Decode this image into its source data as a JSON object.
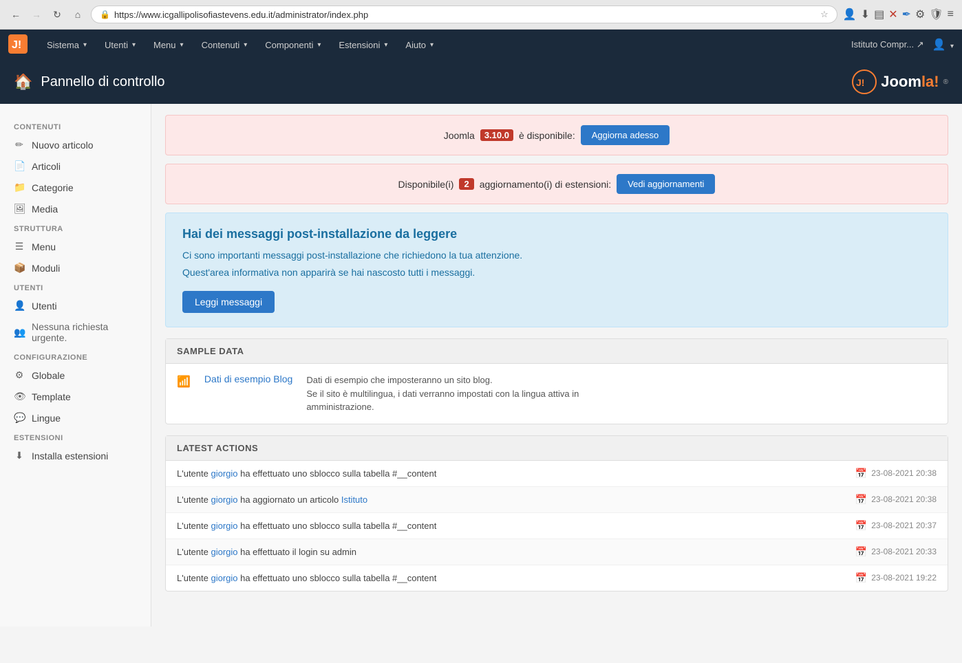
{
  "browser": {
    "url": "https://www.icgallipolisofiastevens.edu.it/administrator/index.php",
    "back_disabled": false,
    "forward_disabled": true
  },
  "topnav": {
    "items": [
      {
        "label": "Sistema",
        "has_dropdown": true
      },
      {
        "label": "Utenti",
        "has_dropdown": true
      },
      {
        "label": "Menu",
        "has_dropdown": true
      },
      {
        "label": "Contenuti",
        "has_dropdown": true
      },
      {
        "label": "Componenti",
        "has_dropdown": true
      },
      {
        "label": "Estensioni",
        "has_dropdown": true
      },
      {
        "label": "Aiuto",
        "has_dropdown": true
      }
    ],
    "site_link": "Istituto Compr... ↗",
    "user_icon": "👤"
  },
  "page_header": {
    "title": "Pannello di controllo",
    "icon": "🏠",
    "brand": "Joomla!"
  },
  "alerts": [
    {
      "pre_text": "Joomla",
      "version": "3.10.0",
      "post_text": "è disponibile:",
      "button_label": "Aggiorna adesso"
    },
    {
      "pre_text": "Disponibile(i)",
      "count": "2",
      "post_text": "aggiornamento(i) di estensioni:",
      "button_label": "Vedi aggiornamenti"
    }
  ],
  "info_box": {
    "title": "Hai dei messaggi post-installazione da leggere",
    "lines": [
      "Ci sono importanti messaggi post-installazione che richiedono la tua attenzione.",
      "Quest'area informativa non apparirà se hai nascosto tutti i messaggi."
    ],
    "button_label": "Leggi messaggi"
  },
  "sample_data": {
    "section_title": "SAMPLE DATA",
    "items": [
      {
        "icon": "📶",
        "link": "Dati di esempio Blog",
        "desc_lines": [
          "Dati di esempio che imposteranno un sito blog.",
          "Se il sito è multilingua, i dati verranno impostati con la lingua attiva in",
          "amministrazione."
        ]
      }
    ]
  },
  "latest_actions": {
    "section_title": "LATEST ACTIONS",
    "items": [
      {
        "text_pre": "L'utente",
        "user_link": "giorgio",
        "text_mid": "ha effettuato uno sblocco sulla tabella #__content",
        "text_post": "",
        "page_link": "",
        "date": "23-08-2021 20:38"
      },
      {
        "text_pre": "L'utente",
        "user_link": "giorgio",
        "text_mid": "ha aggiornato un articolo",
        "text_post": "",
        "page_link": "Istituto",
        "date": "23-08-2021 20:38"
      },
      {
        "text_pre": "L'utente",
        "user_link": "giorgio",
        "text_mid": "ha effettuato uno sblocco sulla tabella #__content",
        "text_post": "",
        "page_link": "",
        "date": "23-08-2021 20:37"
      },
      {
        "text_pre": "L'utente",
        "user_link": "giorgio",
        "text_mid": "ha effettuato il login su admin",
        "text_post": "",
        "page_link": "",
        "date": "23-08-2021 20:33"
      },
      {
        "text_pre": "L'utente",
        "user_link": "giorgio",
        "text_mid": "ha effettuato uno sblocco sulla tabella #__content",
        "text_post": "",
        "page_link": "",
        "date": "23-08-2021 19:22"
      }
    ]
  },
  "sidebar": {
    "sections": [
      {
        "title": "CONTENUTI",
        "items": [
          {
            "icon": "✏️",
            "label": "Nuovo articolo",
            "interactable": true
          },
          {
            "icon": "📋",
            "label": "Articoli",
            "interactable": true
          },
          {
            "icon": "📁",
            "label": "Categorie",
            "interactable": true
          },
          {
            "icon": "🖼️",
            "label": "Media",
            "interactable": true
          }
        ]
      },
      {
        "title": "STRUTTURA",
        "items": [
          {
            "icon": "☰",
            "label": "Menu",
            "interactable": true
          },
          {
            "icon": "📦",
            "label": "Moduli",
            "interactable": true
          }
        ]
      },
      {
        "title": "UTENTI",
        "items": [
          {
            "icon": "👤",
            "label": "Utenti",
            "interactable": true
          },
          {
            "icon": "👥",
            "label": "Nessuna richiesta urgente.",
            "interactable": false,
            "static": true
          }
        ]
      },
      {
        "title": "CONFIGURAZIONE",
        "items": [
          {
            "icon": "⚙️",
            "label": "Globale",
            "interactable": true
          },
          {
            "icon": "👁️",
            "label": "Template",
            "interactable": true
          },
          {
            "icon": "💬",
            "label": "Lingue",
            "interactable": true
          }
        ]
      },
      {
        "title": "ESTENSIONI",
        "items": [
          {
            "icon": "⬇️",
            "label": "Installa estensioni",
            "interactable": true
          }
        ]
      }
    ]
  }
}
